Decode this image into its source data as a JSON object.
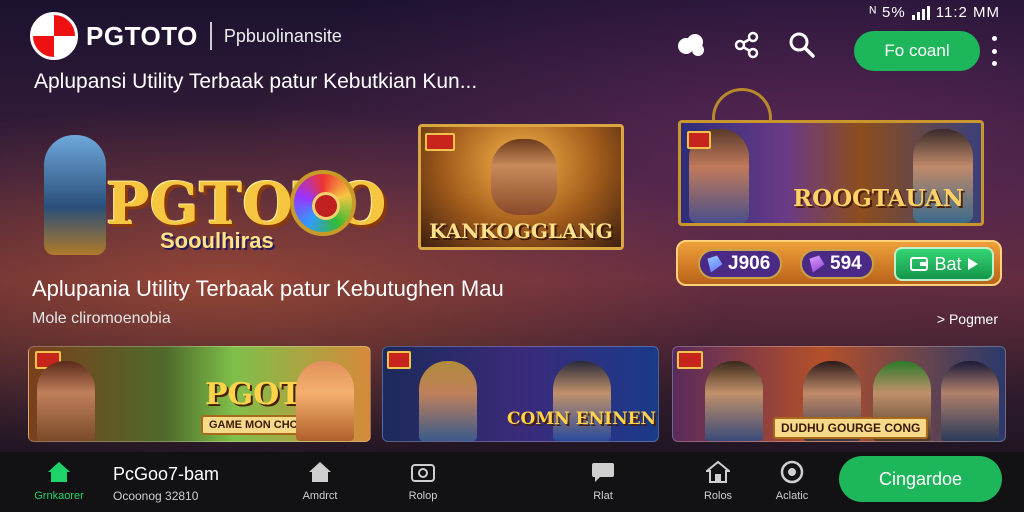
{
  "status_bar": {
    "text": "ᴺ 5%",
    "time": "11:2 MM"
  },
  "header": {
    "logo": "PGTOTO",
    "subtitle": "Ppbuolinansite",
    "cta": "Fo coanl",
    "icons": [
      "share-cloud-icon",
      "share-icon",
      "search-icon",
      "more-vert-icon"
    ]
  },
  "tagline": "Aplupansi Utility Terbaak patur Kebutkian Kun...",
  "hero": {
    "logo_text": "PGTOTO",
    "logo_sub": "Sooulhiras"
  },
  "featured_card": {
    "title": "KANKOGGLANG"
  },
  "promo_card": {
    "title": "ROOGTAUAN"
  },
  "stats": {
    "value_1": "J906",
    "value_2": "594",
    "button": "Bat"
  },
  "section": {
    "title": "Aplupania Utility Terbaak patur Kebutughen Mau",
    "subtitle": "Mole cliromoenobia",
    "see_more": "> Pogmer"
  },
  "games": [
    {
      "title": "PGOTO",
      "subtitle": "GAME MON CHCAK"
    },
    {
      "title": "COMN ENINEN"
    },
    {
      "title": "DUDHU GOURGE CONG"
    }
  ],
  "bottom_nav": {
    "home": "Grnkaorer",
    "profile_name": "PcGoo7-bam",
    "profile_sub": "Ocoonog 32810",
    "items": [
      "Amdrct",
      "Rolop",
      "Rlat",
      "Rolos",
      "Aclatic"
    ],
    "cta": "Cingardoe"
  },
  "colors": {
    "accent": "#1eb65a",
    "gold": "#f7c640"
  }
}
